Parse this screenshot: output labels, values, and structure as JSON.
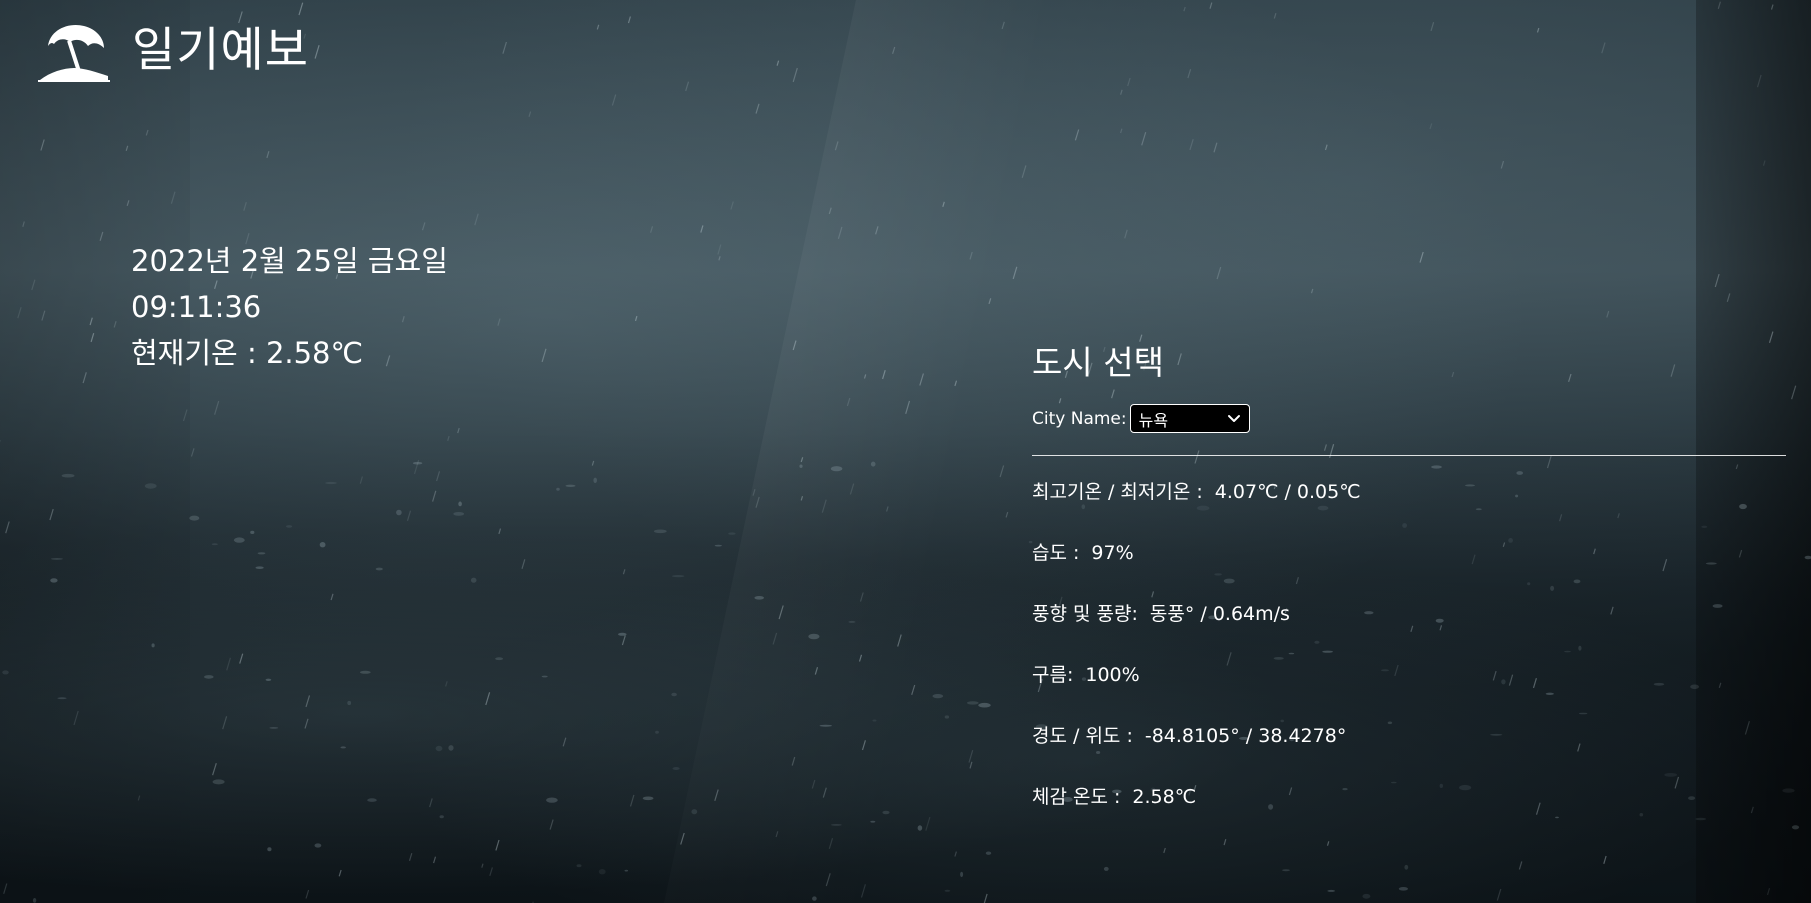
{
  "header": {
    "logo_icon": "beach-umbrella-icon",
    "title": "일기예보"
  },
  "current": {
    "date": "2022년 2월 25일 금요일",
    "time": "09:11:36",
    "temp_label": "현재기온 :",
    "temp_value": "2.58℃"
  },
  "city_panel": {
    "title": "도시 선택",
    "city_label": "City Name:",
    "city_selected": "뉴욕",
    "select_icon": "chevron-down-icon"
  },
  "details": [
    {
      "label": "최고기온 / 최저기온 :",
      "value": "4.07℃ / 0.05℃"
    },
    {
      "label": "습도 :",
      "value": "97%"
    },
    {
      "label": "풍향 및 풍량:",
      "value": "동풍° / 0.64m/s"
    },
    {
      "label": "구름:",
      "value": "100%"
    },
    {
      "label": "경도 / 위도 :",
      "value": "-84.8105° / 38.4278°"
    },
    {
      "label": "체감 온도 :",
      "value": "2.58℃"
    }
  ]
}
